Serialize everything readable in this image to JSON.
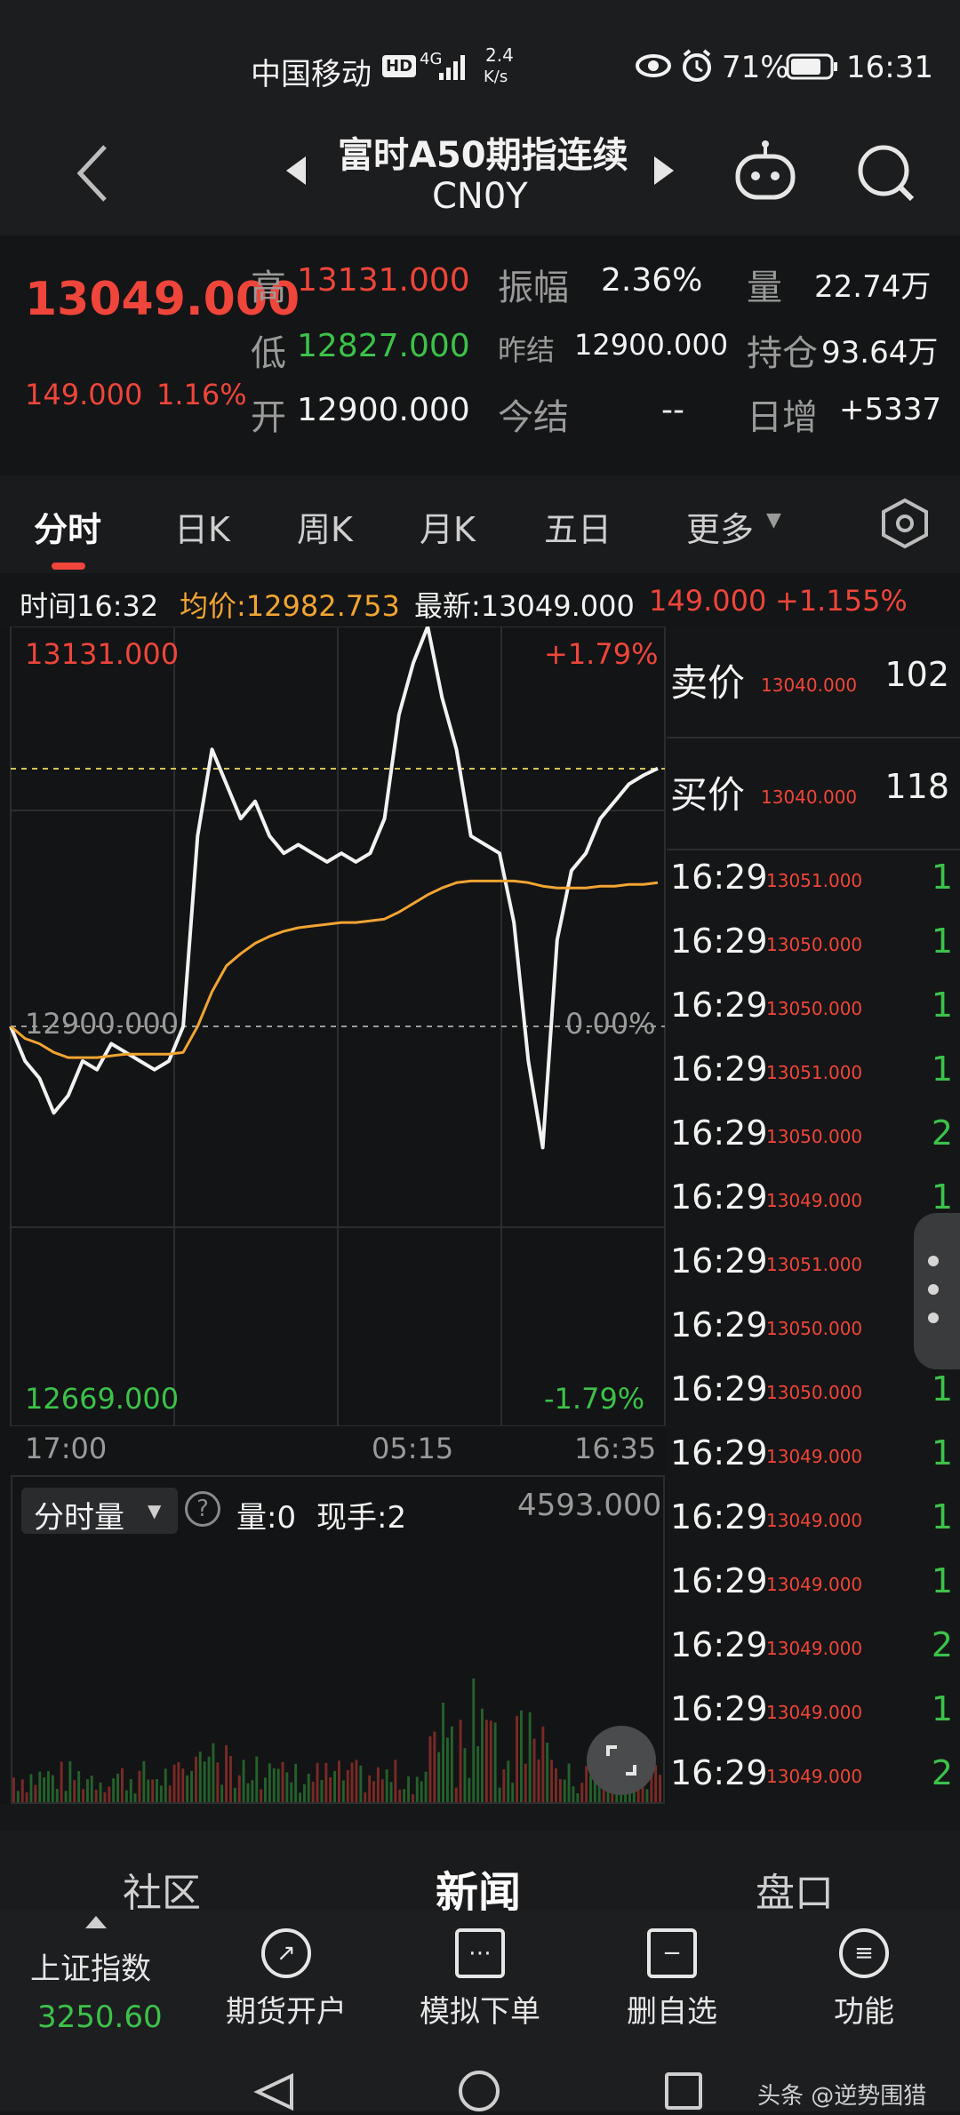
{
  "status_bar": {
    "carrier": "中国移动",
    "net_hd": "HD",
    "net_gen": "4G",
    "speed_val": "2.4",
    "speed_unit": "K/s",
    "battery": "71%",
    "time": "16:31"
  },
  "header": {
    "title": "富时A50期指连续",
    "code": "CN0Y"
  },
  "quote": {
    "last": "13049.000",
    "change": "149.000",
    "change_pct": "1.16%",
    "high_label": "高",
    "high": "13131.000",
    "low_label": "低",
    "low": "12827.000",
    "open_label": "开",
    "open": "12900.000",
    "amplitude_label": "振幅",
    "amplitude": "2.36%",
    "prev_settle_label": "昨结",
    "prev_settle": "12900.000",
    "settle_label": "今结",
    "settle": "--",
    "volume_label": "量",
    "volume": "22.74万",
    "oi_label": "持仓",
    "oi": "93.64万",
    "daily_inc_label": "日增",
    "daily_inc": "+5337"
  },
  "tabs": [
    "分时",
    "日K",
    "周K",
    "月K",
    "五日",
    "更多"
  ],
  "info_bar": {
    "time": "时间16:32",
    "avg": "均价:12982.753",
    "latest": "最新:13049.000",
    "chg": "149.000",
    "chg_pct": "+1.155%"
  },
  "chart_labels": {
    "top_price": "13131.000",
    "top_pct": "+1.79%",
    "mid_price": "12900.000",
    "mid_pct": "0.00%",
    "bottom_price": "12669.000",
    "bottom_pct": "-1.79%",
    "x_start": "17:00",
    "x_mid": "05:15",
    "x_end": "16:35"
  },
  "volume_panel": {
    "selector": "分时量",
    "qty": "量:0",
    "now_hand": "现手:2",
    "max": "4593.000"
  },
  "orderbook": {
    "ask_label": "卖价",
    "ask_price": "13040.000",
    "ask_size": "102",
    "bid_label": "买价",
    "bid_price": "13040.000",
    "bid_size": "118"
  },
  "ticks": [
    {
      "t": "16:29",
      "p": "13051.000",
      "v": "1"
    },
    {
      "t": "16:29",
      "p": "13050.000",
      "v": "1"
    },
    {
      "t": "16:29",
      "p": "13050.000",
      "v": "1"
    },
    {
      "t": "16:29",
      "p": "13051.000",
      "v": "1"
    },
    {
      "t": "16:29",
      "p": "13050.000",
      "v": "2"
    },
    {
      "t": "16:29",
      "p": "13049.000",
      "v": "1"
    },
    {
      "t": "16:29",
      "p": "13051.000",
      "v": "1"
    },
    {
      "t": "16:29",
      "p": "13050.000",
      "v": "1"
    },
    {
      "t": "16:29",
      "p": "13050.000",
      "v": "1"
    },
    {
      "t": "16:29",
      "p": "13049.000",
      "v": "1"
    },
    {
      "t": "16:29",
      "p": "13049.000",
      "v": "1"
    },
    {
      "t": "16:29",
      "p": "13049.000",
      "v": "1"
    },
    {
      "t": "16:29",
      "p": "13049.000",
      "v": "2"
    },
    {
      "t": "16:29",
      "p": "13049.000",
      "v": "1"
    },
    {
      "t": "16:29",
      "p": "13049.000",
      "v": "2"
    }
  ],
  "bottom_tabs": [
    "社区",
    "新闻",
    "盘口"
  ],
  "bottom_nav": {
    "index_name": "上证指数",
    "index_value": "3250.60",
    "items": [
      "期货开户",
      "模拟下单",
      "删自选",
      "功能"
    ]
  },
  "watermark": "头条 @逆势围猎",
  "chart_data": {
    "type": "line",
    "x_labels": [
      "17:00",
      "05:15",
      "16:35"
    ],
    "ylim": [
      12669,
      13131
    ],
    "baseline": 12900,
    "series": [
      {
        "name": "",
        "color": "#f2f2f2",
        "values": [
          12900,
          12880,
          12870,
          12850,
          12860,
          12880,
          12875,
          12890,
          12885,
          12880,
          12875,
          12880,
          12900,
          13010,
          13060,
          13040,
          13020,
          13030,
          13010,
          13000,
          13005,
          13000,
          12995,
          13000,
          12995,
          13000,
          13020,
          13080,
          13110,
          13131,
          13090,
          13060,
          13010,
          13005,
          13000,
          12960,
          12880,
          12830,
          12950,
          12990,
          13000,
          13020,
          13030,
          13040,
          13045,
          13049
        ]
      },
      {
        "name": "",
        "color": "#f2a431",
        "values": [
          12900,
          12893,
          12890,
          12885,
          12882,
          12882,
          12882,
          12883,
          12884,
          12884,
          12884,
          12884,
          12885,
          12900,
          12920,
          12935,
          12942,
          12948,
          12952,
          12955,
          12957,
          12958,
          12959,
          12960,
          12960,
          12961,
          12962,
          12966,
          12971,
          12976,
          12980,
          12983,
          12984,
          12984,
          12984,
          12984,
          12983,
          12981,
          12980,
          12980,
          12980,
          12981,
          12981,
          12982,
          12982,
          12983
        ]
      }
    ]
  }
}
